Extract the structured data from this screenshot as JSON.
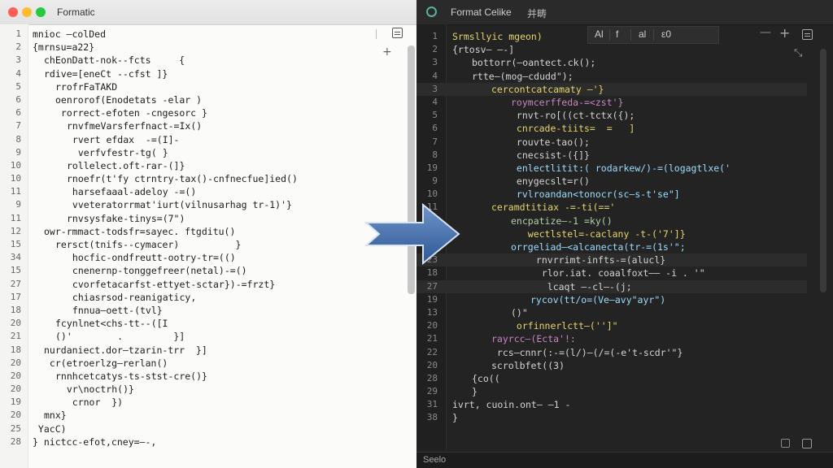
{
  "left_window": {
    "title": "Formatic",
    "lines": [
      {
        "n": "1",
        "indent": 0,
        "text": "mnioc —colDed"
      },
      {
        "n": "2",
        "indent": 0,
        "text": "{mrnsu=a22}"
      },
      {
        "n": "3",
        "indent": 1,
        "text": "chEonDatt-nok--fcts     {"
      },
      {
        "n": "4",
        "indent": 1,
        "text": "rdive=[eneCt --cfst ]}"
      },
      {
        "n": "5",
        "indent": 2,
        "text": "rrofrFaTAKD"
      },
      {
        "n": "6",
        "indent": 2,
        "text": "oenrorof(Enodetats -elar )"
      },
      {
        "n": "6",
        "indent": 2,
        "text": " rorrect-efoten -cngesorc }"
      },
      {
        "n": "7",
        "indent": 3,
        "text": "rnvfmeVarsferfnact-=Ix()"
      },
      {
        "n": "8",
        "indent": 3,
        "text": " rvert efdax  -=(I]-"
      },
      {
        "n": "9",
        "indent": 3,
        "text": "  verfvfestr-tg( }"
      },
      {
        "n": "10",
        "indent": 3,
        "text": "rollelect.oft-rar-(]}"
      },
      {
        "n": "10",
        "indent": 3,
        "text": "rnoefr(t'fy ctrntry-tax()-cnfnecfue]ied()"
      },
      {
        "n": "11",
        "indent": 3,
        "text": " harsefaaal-adeloy -=()"
      },
      {
        "n": "9",
        "indent": 3,
        "text": " vveteratorrmat'iurt(vilnusarhag tr-1)'}"
      },
      {
        "n": "11",
        "indent": 3,
        "text": "rnvsysfake-tinys=(7\")"
      },
      {
        "n": "12",
        "indent": 1,
        "text": "owr-rmmact-todsfr=sayec. ftgditu()"
      },
      {
        "n": "15",
        "indent": 2,
        "text": "rersct(tnifs--cymacer)          }"
      },
      {
        "n": "34",
        "indent": 3,
        "text": " hocfic-ondfreutt-ootry-tr=(()"
      },
      {
        "n": "15",
        "indent": 3,
        "text": " cnenernp-tonggefreer(netal)-=()"
      },
      {
        "n": "27",
        "indent": 3,
        "text": " cvorfetacarfst-ettyet-sctar})-=frzt}"
      },
      {
        "n": "17",
        "indent": 3,
        "text": " chiasrsod-reanigaticy,"
      },
      {
        "n": "18",
        "indent": 3,
        "text": " fnnua—oett-(tvl}"
      },
      {
        "n": "20",
        "indent": 2,
        "text": "fcynlnet<chs-tt--([I"
      },
      {
        "n": "21",
        "indent": 2,
        "text": "()'        .         }]"
      },
      {
        "n": "18",
        "indent": 1,
        "text": "nurdaniect.dor—tzarin-trr  }]"
      },
      {
        "n": "20",
        "indent": 1,
        "text": " cr(etroerlzg—rerlan()"
      },
      {
        "n": "20",
        "indent": 2,
        "text": "rnnhcetcatys-ts-stst-cre()}"
      },
      {
        "n": "20",
        "indent": 2,
        "text": "  vr\\noctrh()}"
      },
      {
        "n": "19",
        "indent": 2,
        "text": "   crnor  })"
      },
      {
        "n": "20",
        "indent": 1,
        "text": "mnx}"
      },
      {
        "n": "25",
        "indent": 0,
        "text": " YacC)"
      },
      {
        "n": "28",
        "indent": 0,
        "text": "} nictcc-efot,cney=—-,"
      }
    ]
  },
  "right_window": {
    "title": "Format Celike",
    "title_extra": "并畴",
    "toolbar": [
      "Al",
      "f",
      "al",
      "ε0"
    ],
    "status": "Seelo",
    "lines": [
      {
        "n": "1",
        "indent": 0,
        "c": 0,
        "text": "Srmsllyic mgeon)"
      },
      {
        "n": "2",
        "indent": 0,
        "c": 1,
        "text": "{rtosv— —-]"
      },
      {
        "n": "3",
        "indent": 1,
        "c": 1,
        "text": "bottorr(—oantect.ck();"
      },
      {
        "n": "4",
        "indent": 1,
        "c": 1,
        "text": "rtte—(mog—cdudd\");"
      },
      {
        "n": "3",
        "indent": 2,
        "c": 0,
        "text": "cercontcatcamaty —'}",
        "hl": true
      },
      {
        "n": "4",
        "indent": 3,
        "c": 3,
        "text": "roymcerffeda-=<zst'}"
      },
      {
        "n": "5",
        "indent": 3,
        "c": 1,
        "text": " rnvt-ro[((ct-tctx({);"
      },
      {
        "n": "6",
        "indent": 3,
        "c": 0,
        "text": " cnrcade-tiits=  =   ]"
      },
      {
        "n": "7",
        "indent": 3,
        "c": 1,
        "text": " rouvte-tao();"
      },
      {
        "n": "8",
        "indent": 3,
        "c": 1,
        "text": " cnecsist-({]}"
      },
      {
        "n": "19",
        "indent": 3,
        "c": 2,
        "text": " enlectlitit:( rodarkew/)-=(logagtlxe('"
      },
      {
        "n": "9",
        "indent": 3,
        "c": 1,
        "text": " enygecslt=r()"
      },
      {
        "n": "10",
        "indent": 3,
        "c": 2,
        "text": " rvlroandan<tonocr(sc—s-t'se\"]"
      },
      {
        "n": "11",
        "indent": 2,
        "c": 0,
        "text": "ceramdtitiax -=-ti(=='"
      },
      {
        "n": "15",
        "indent": 3,
        "c": 5,
        "text": "encpatize—-1 =ky()"
      },
      {
        "n": "18",
        "indent": 3,
        "c": 0,
        "text": "   wectlstel=-caclany -t-('7']}"
      },
      {
        "n": "17",
        "indent": 3,
        "c": 2,
        "text": "orrgeliad—<alcanecta(tr-=(1s'\";"
      },
      {
        "n": "23",
        "indent": 4,
        "c": 1,
        "text": " rnvrrimt-infts-=(alucl}",
        "hl": true
      },
      {
        "n": "18",
        "indent": 4,
        "c": 1,
        "text": "  rlor.iat. coaalfoxt—— -i . '\""
      },
      {
        "n": "27",
        "indent": 4,
        "c": 1,
        "text": "   lcaqt —-cl—-(j;",
        "hl": true
      },
      {
        "n": "19",
        "indent": 4,
        "c": 2,
        "text": "rycov(tt/o=(Ve—avy\"ayr\")"
      },
      {
        "n": "13",
        "indent": 3,
        "c": 1,
        "text": "()\""
      },
      {
        "n": "20",
        "indent": 3,
        "c": 0,
        "text": " orfinnerlctt—('']\""
      },
      {
        "n": "21",
        "indent": 2,
        "c": 3,
        "text": "rayrcc—(Ecta'!:"
      },
      {
        "n": "22",
        "indent": 2,
        "c": 1,
        "text": " rcs—cnnr(:-=(l/)—(/=(-e't-scdr'\"}"
      },
      {
        "n": "20",
        "indent": 2,
        "c": 1,
        "text": "scrolbfet((3)"
      },
      {
        "n": "28",
        "indent": 1,
        "c": 1,
        "text": "{co(("
      },
      {
        "n": "29",
        "indent": 1,
        "c": 1,
        "text": "}"
      },
      {
        "n": "31",
        "indent": 0,
        "c": 1,
        "text": "ivrt, cuoin.ont— —1 -"
      },
      {
        "n": "38",
        "indent": 0,
        "c": 1,
        "text": "}"
      }
    ]
  }
}
